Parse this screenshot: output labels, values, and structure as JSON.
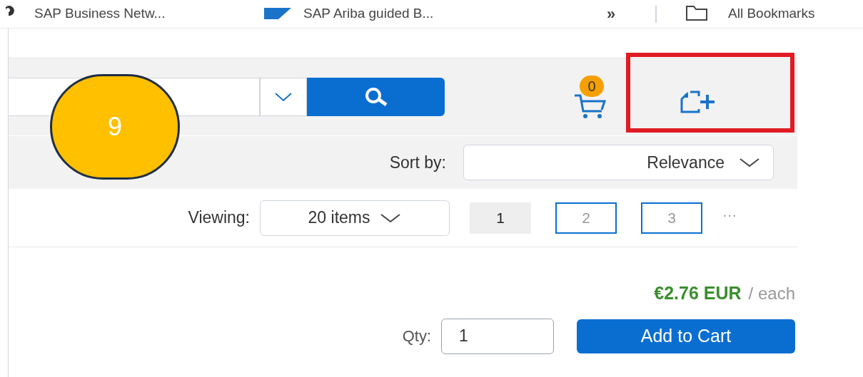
{
  "bookmarks": [
    {
      "label": "SAP Business Netw..."
    },
    {
      "label": "SAP Ariba guided B..."
    }
  ],
  "bookmarks_overflow": "»",
  "all_bookmarks": "All Bookmarks",
  "cart": {
    "count": "0"
  },
  "sort": {
    "label": "Sort by:",
    "value": "Relevance"
  },
  "viewing": {
    "label": "Viewing:",
    "value": "20 items"
  },
  "pages": [
    {
      "label": "1",
      "selected": true
    },
    {
      "label": "2",
      "selected": false
    },
    {
      "label": "3",
      "selected": false
    }
  ],
  "more_pages": "···",
  "price": {
    "amount": "€2.76 EUR",
    "unit": "/ each"
  },
  "qty": {
    "label": "Qty:",
    "value": "1"
  },
  "add_button": "Add to Cart",
  "annotation": {
    "label": "9"
  }
}
